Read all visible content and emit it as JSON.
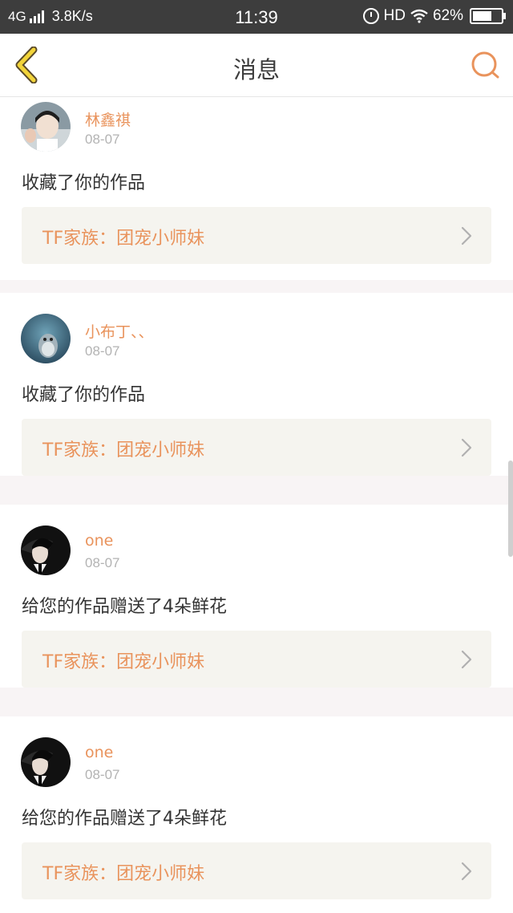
{
  "status_bar": {
    "network": "4G",
    "speed": "3.8K/s",
    "time": "11:39",
    "hd": "HD",
    "battery": "62%"
  },
  "header": {
    "title": "消息"
  },
  "messages": [
    {
      "username": "林鑫祺",
      "date": "08-07",
      "text": "收藏了你的作品",
      "work": "TF家族：团宠小师妹"
    },
    {
      "username": "小布丁、、",
      "date": "08-07",
      "text": "收藏了你的作品",
      "work": "TF家族：团宠小师妹"
    },
    {
      "username": "one",
      "date": "08-07",
      "text": "给您的作品赠送了4朵鲜花",
      "work": "TF家族：团宠小师妹"
    },
    {
      "username": "one",
      "date": "08-07",
      "text": "给您的作品赠送了4朵鲜花",
      "work": "TF家族：团宠小师妹"
    }
  ],
  "colors": {
    "accent": "#e9935c",
    "status_bar_bg": "#3d3d3d",
    "work_link_bg": "#f5f4ef"
  }
}
